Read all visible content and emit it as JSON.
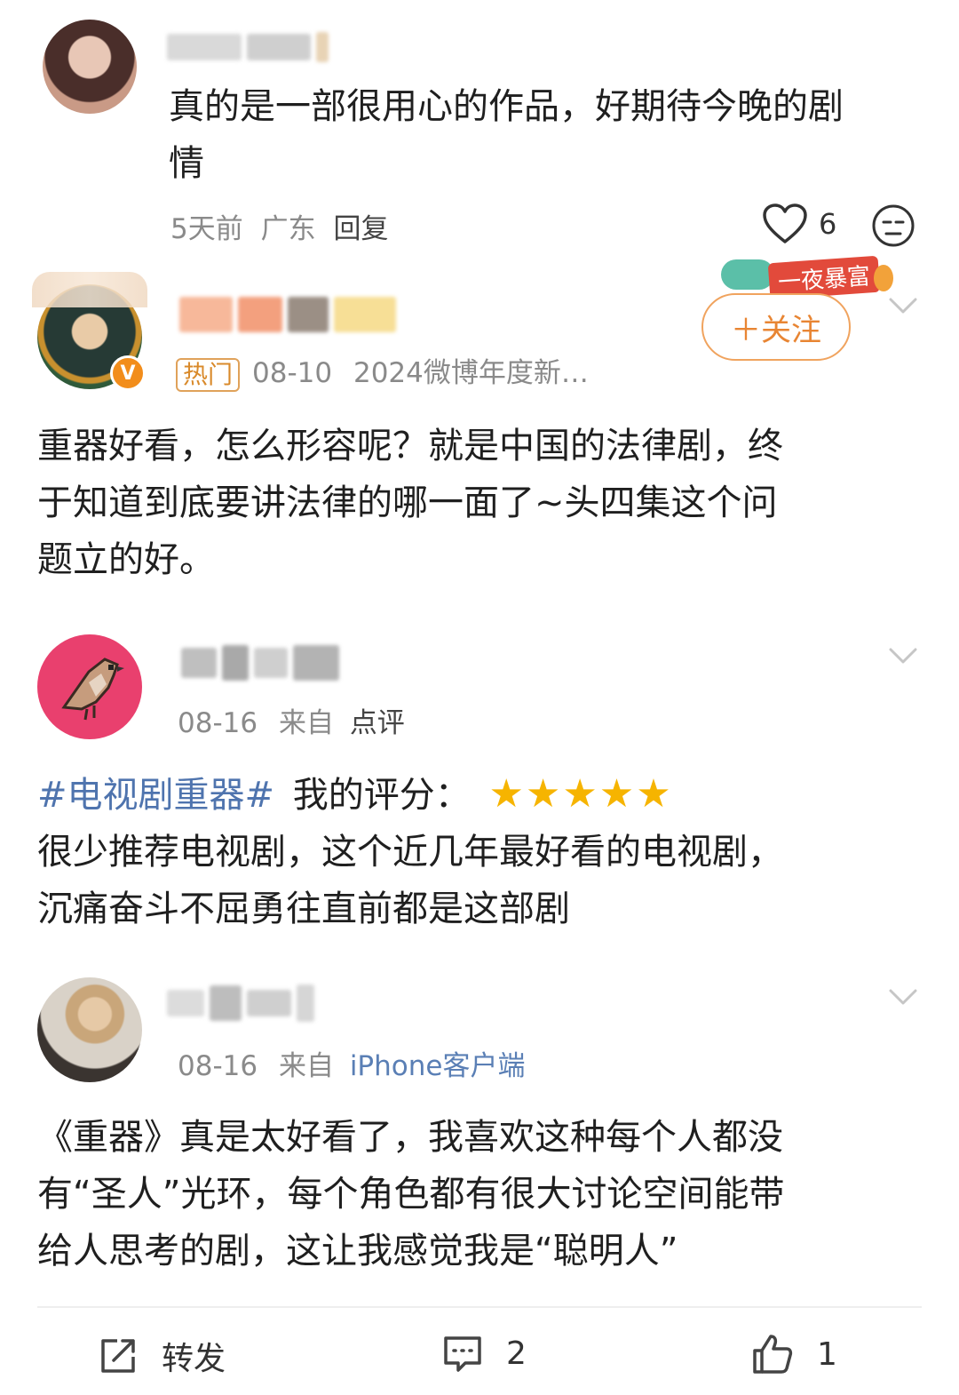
{
  "comment1": {
    "text_lines": [
      "真的是一部很用心的作品，好期待今晚的剧",
      "情"
    ],
    "time": "5天前",
    "location": "广东",
    "reply_label": "回复",
    "like_count": "6",
    "icons": [
      "heart-icon",
      "face-icon"
    ]
  },
  "post1": {
    "hot_tag": "热门",
    "date": "08-10",
    "source": "2024微博年度新…",
    "badge": "一夜暴富",
    "follow_label": "＋关注",
    "text_lines": [
      "重器好看，怎么形容呢？就是中国的法律剧，终",
      "于知道到底要讲法律的哪一面了~头四集这个问",
      "题立的好。"
    ]
  },
  "post2": {
    "date": "08-16",
    "from_label": "来自",
    "source": "点评",
    "hashtag": "#电视剧重器#",
    "rating_label": "我的评分：",
    "stars": "★★★★★",
    "rating": 5,
    "text_lines": [
      "很少推荐电视剧，这个近几年最好看的电视剧，",
      "沉痛奋斗不屈勇往直前都是这部剧"
    ]
  },
  "post3": {
    "date": "08-16",
    "from_label": "来自",
    "source": "iPhone客户端",
    "text_lines": [
      "《重器》真是太好看了，我喜欢这种每个人都没",
      "有“圣人”光环，每个角色都有很大讨论空间能带",
      "给人思考的剧，这让我感觉我是“聪明人”"
    ]
  },
  "action_bar": {
    "repost_label": "转发",
    "comment_count": "2",
    "like_count": "1"
  },
  "colors": {
    "link_blue": "#5a7fb5",
    "hashtag_blue": "#4f74ae",
    "star_gold": "#f6b400",
    "follow_orange": "#e88533"
  }
}
